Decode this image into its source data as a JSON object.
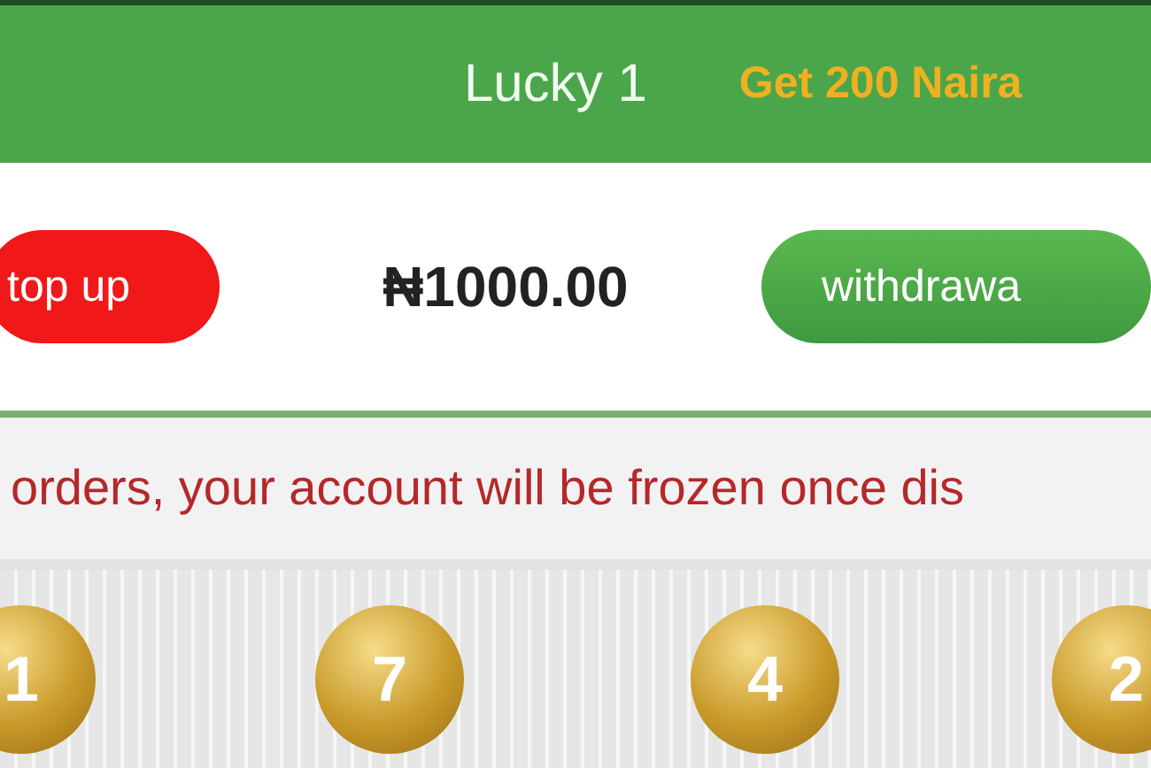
{
  "header": {
    "title": "Lucky 1",
    "promo": "Get 200 Naira"
  },
  "balance": {
    "top_up_button": "top up",
    "amount": "₦1000.00",
    "withdraw_button": "withdrawa"
  },
  "notice": "orders, your account will be frozen once dis",
  "balls": [
    "1",
    "7",
    "4",
    "2"
  ]
}
